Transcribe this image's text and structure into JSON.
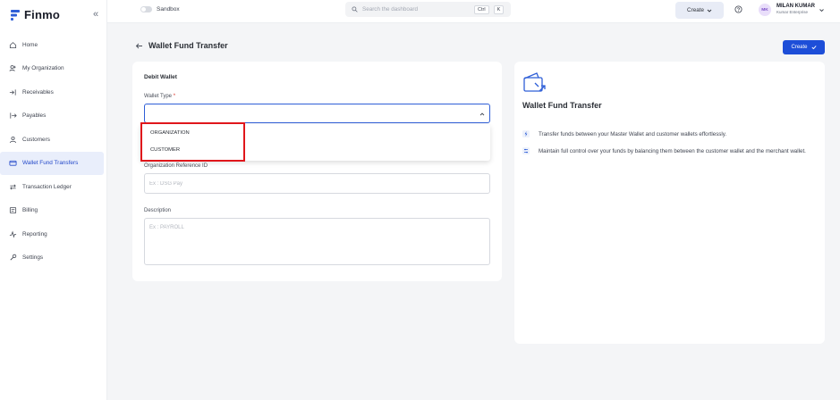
{
  "brand": {
    "name": "Finmo"
  },
  "sidebar": {
    "items": [
      {
        "label": "Home",
        "icon": "home-icon"
      },
      {
        "label": "My Organization",
        "icon": "organization-icon"
      },
      {
        "label": "Receivables",
        "icon": "receivables-icon"
      },
      {
        "label": "Payables",
        "icon": "payables-icon"
      },
      {
        "label": "Customers",
        "icon": "customers-icon"
      },
      {
        "label": "Wallet Fund Transfers",
        "icon": "wallet-icon",
        "active": true
      },
      {
        "label": "Transaction Ledger",
        "icon": "ledger-icon"
      },
      {
        "label": "Billing",
        "icon": "billing-icon"
      },
      {
        "label": "Reporting",
        "icon": "reporting-icon"
      },
      {
        "label": "Settings",
        "icon": "settings-icon"
      }
    ]
  },
  "header": {
    "sandbox_label": "Sandbox",
    "search_placeholder": "Search the dashboard",
    "shortcut_key1": "Ctrl",
    "shortcut_key2": "K",
    "create_label": "Create",
    "user": {
      "initials": "MK",
      "name": "MILAN KUMAR",
      "org": "Kumar Enterprise"
    }
  },
  "page": {
    "title": "Wallet Fund Transfer",
    "create_button": "Create"
  },
  "form": {
    "section_title": "Debit Wallet",
    "wallet_type_label": "Wallet Type",
    "required_mark": "*",
    "wallet_type_options": [
      "ORGANIZATION",
      "CUSTOMER"
    ],
    "org_ref_label": "Organization Reference ID",
    "org_ref_placeholder": "Ex : DSG Pay",
    "description_label": "Description",
    "description_placeholder": "Ex : PAYROLL"
  },
  "info": {
    "title": "Wallet Fund Transfer",
    "points": [
      "Transfer funds between your Master Wallet and customer wallets effortlessly.",
      "Maintain full control over your funds by balancing them between the customer wallet and the merchant wallet."
    ]
  },
  "colors": {
    "accent": "#1d4ed8",
    "highlight": "#e0161b",
    "active_nav": "#2348c9"
  }
}
